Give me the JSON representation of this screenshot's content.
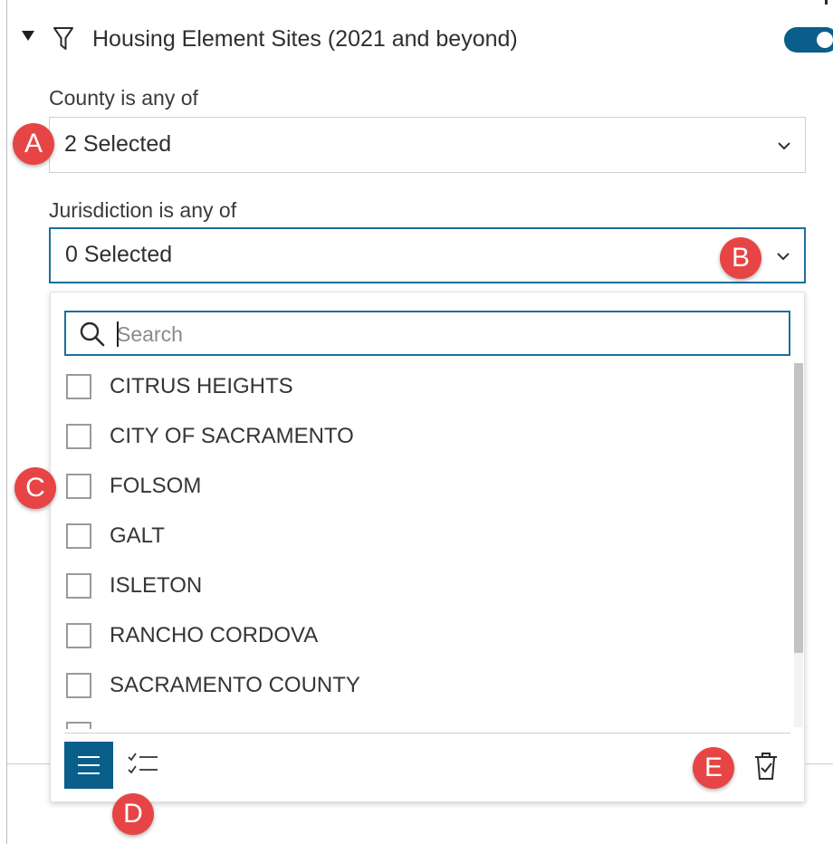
{
  "layer": {
    "title": "Housing Element Sites (2021 and beyond)",
    "expand_icon": "caret-down-icon",
    "filter_icon": "funnel-filter-icon",
    "visible_toggle_on": true
  },
  "filters": [
    {
      "label": "County is any of",
      "value": "2 Selected",
      "chevron_icon": "chevron-down-icon"
    },
    {
      "label": "Jurisdiction is any of",
      "value": "0 Selected",
      "chevron_icon": "chevron-down-icon"
    }
  ],
  "dropdown": {
    "search_placeholder": "Search",
    "search_icon": "magnifier-icon",
    "options": [
      "CITRUS HEIGHTS",
      "CITY OF SACRAMENTO",
      "FOLSOM",
      "GALT",
      "ISLETON",
      "RANCHO CORDOVA",
      "SACRAMENTO COUNTY"
    ],
    "footer": {
      "list_view_icon": "list-lines-icon",
      "checklist_icon": "checklist-icon",
      "clear_icon": "trash-check-icon"
    }
  },
  "markers": [
    "A",
    "B",
    "C",
    "D",
    "E"
  ],
  "colors": {
    "accent": "#0a5e8a",
    "focus_border": "#1d6f9a",
    "marker": "#e74545",
    "text": "#323232"
  }
}
